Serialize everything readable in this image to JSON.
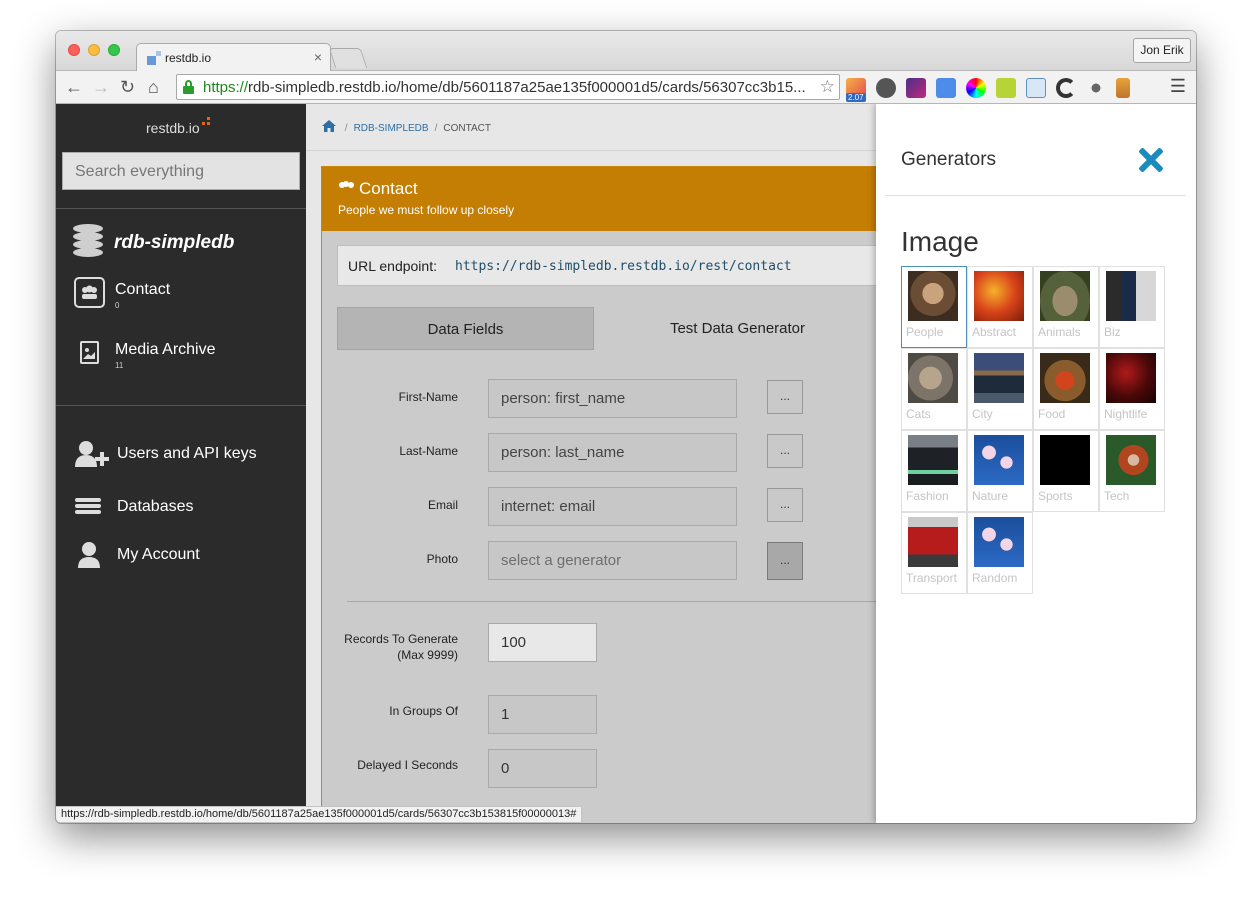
{
  "browser": {
    "tab_title": "restdb.io",
    "tab_close": "×",
    "profile": "Jon Erik",
    "url_scheme": "https://",
    "url_rest": "rdb-simpledb.restdb.io/home/db/5601187a25ae135f000001d5/cards/56307cc3b15...",
    "extension_badge": "2.07",
    "status_url": "https://rdb-simpledb.restdb.io/home/db/5601187a25ae135f000001d5/cards/56307cc3b153815f00000013#"
  },
  "sidebar": {
    "logo": "restdb.io",
    "search_placeholder": "Search everything",
    "db_name": "rdb-simpledb",
    "collections": [
      {
        "label": "Contact",
        "count": "0"
      },
      {
        "label": "Media Archive",
        "count": "11"
      }
    ],
    "links": [
      {
        "label": "Users and API keys"
      },
      {
        "label": "Databases"
      },
      {
        "label": "My Account"
      }
    ]
  },
  "breadcrumb": {
    "db": "RDB-SIMPLEDB",
    "sep": "/",
    "current": "CONTACT"
  },
  "card": {
    "title": "Contact",
    "subtitle": "People we must follow up closely",
    "endpoint_label": "URL endpoint:",
    "endpoint_url": "https://rdb-simpledb.restdb.io/rest/contact",
    "tabs": [
      {
        "label": "Data Fields"
      },
      {
        "label": "Test Data Generator"
      }
    ],
    "fields": [
      {
        "label": "First-Name",
        "value": "person: first_name",
        "button": "..."
      },
      {
        "label": "Last-Name",
        "value": "person: last_name",
        "button": "..."
      },
      {
        "label": "Email",
        "value": "internet: email",
        "button": "..."
      },
      {
        "label": "Photo",
        "placeholder": "select a generator",
        "button": "..."
      }
    ],
    "settings": [
      {
        "label": "Records To Generate (Max 9999)",
        "value": "100"
      },
      {
        "label": "In Groups Of",
        "value": "1"
      },
      {
        "label": "Delayed I Seconds",
        "value": "0"
      }
    ]
  },
  "panel": {
    "title": "Generators",
    "heading": "Image",
    "items": [
      {
        "label": "People"
      },
      {
        "label": "Abstract"
      },
      {
        "label": "Animals"
      },
      {
        "label": "Biz"
      },
      {
        "label": "Cats"
      },
      {
        "label": "City"
      },
      {
        "label": "Food"
      },
      {
        "label": "Nightlife"
      },
      {
        "label": "Fashion"
      },
      {
        "label": "Nature"
      },
      {
        "label": "Sports"
      },
      {
        "label": "Tech"
      },
      {
        "label": "Transport"
      },
      {
        "label": "Random"
      }
    ]
  },
  "colors": {
    "accent": "#c47e03",
    "sidebar": "#2b2b2b",
    "close": "#1a8bbf"
  }
}
